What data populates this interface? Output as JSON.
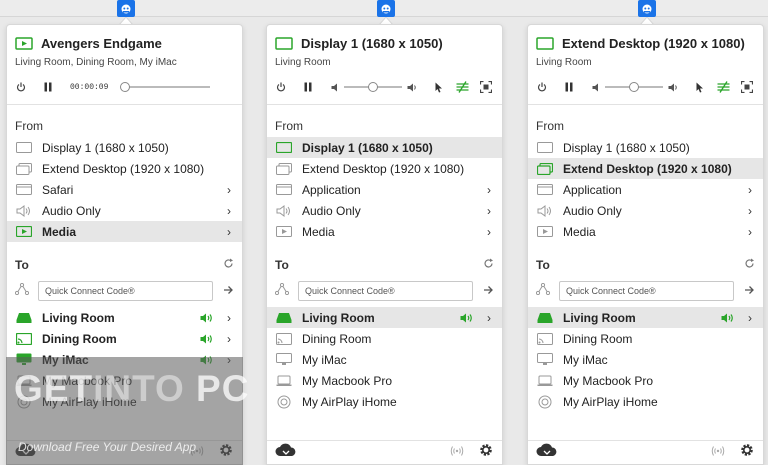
{
  "colors": {
    "accent_green": "#2aa52a",
    "selection_gray": "#e6e6e6",
    "menubar_icon_blue": "#1a73e8"
  },
  "panels": [
    {
      "header": {
        "title": "Avengers Endgame",
        "subtitle": "Living Room, Dining Room, My iMac",
        "title_icon": "media-play-icon",
        "timecode": "00:00:09"
      },
      "from_label": "From",
      "from_items": [
        {
          "label": "Display 1 (1680 x 1050)",
          "icon": "display-icon",
          "selected": false,
          "chevron": false
        },
        {
          "label": "Extend Desktop (1920 x 1080)",
          "icon": "extend-desktop-icon",
          "selected": false,
          "chevron": false
        },
        {
          "label": "Safari",
          "icon": "window-icon",
          "selected": false,
          "chevron": true
        },
        {
          "label": "Audio Only",
          "icon": "speaker-icon",
          "selected": false,
          "chevron": true
        },
        {
          "label": "Media",
          "icon": "media-play-icon",
          "selected": true,
          "chevron": true
        }
      ],
      "to_label": "To",
      "quick_connect_placeholder": "Quick Connect Code®",
      "to_items": [
        {
          "label": "Living Room",
          "icon": "appletv-icon",
          "active": true,
          "selected": false,
          "volume": true,
          "chevron": true
        },
        {
          "label": "Dining Room",
          "icon": "cast-icon",
          "active": true,
          "selected": false,
          "volume": true,
          "chevron": true
        },
        {
          "label": "My iMac",
          "icon": "imac-icon",
          "active": true,
          "selected": false,
          "volume": true,
          "chevron": true
        },
        {
          "label": "My Macbook Pro",
          "icon": "laptop-icon",
          "active": false,
          "selected": false,
          "volume": false,
          "chevron": false
        },
        {
          "label": "My AirPlay iHome",
          "icon": "speaker-round-icon",
          "active": false,
          "selected": false,
          "volume": false,
          "chevron": false
        }
      ]
    },
    {
      "header": {
        "title": "Display 1 (1680 x 1050)",
        "subtitle": "Living Room",
        "title_icon": "display-icon"
      },
      "from_label": "From",
      "from_items": [
        {
          "label": "Display 1 (1680 x 1050)",
          "icon": "display-icon",
          "selected": true,
          "chevron": false
        },
        {
          "label": "Extend Desktop (1920 x 1080)",
          "icon": "extend-desktop-icon",
          "selected": false,
          "chevron": false
        },
        {
          "label": "Application",
          "icon": "window-icon",
          "selected": false,
          "chevron": true
        },
        {
          "label": "Audio Only",
          "icon": "speaker-icon",
          "selected": false,
          "chevron": true
        },
        {
          "label": "Media",
          "icon": "media-play-icon",
          "selected": false,
          "chevron": true
        }
      ],
      "to_label": "To",
      "quick_connect_placeholder": "Quick Connect Code®",
      "to_items": [
        {
          "label": "Living Room",
          "icon": "appletv-icon",
          "active": true,
          "selected": true,
          "volume": true,
          "chevron": true
        },
        {
          "label": "Dining Room",
          "icon": "cast-icon",
          "active": false,
          "selected": false,
          "volume": false,
          "chevron": false
        },
        {
          "label": "My iMac",
          "icon": "imac-icon",
          "active": false,
          "selected": false,
          "volume": false,
          "chevron": false
        },
        {
          "label": "My Macbook Pro",
          "icon": "laptop-icon",
          "active": false,
          "selected": false,
          "volume": false,
          "chevron": false
        },
        {
          "label": "My AirPlay iHome",
          "icon": "speaker-round-icon",
          "active": false,
          "selected": false,
          "volume": false,
          "chevron": false
        }
      ]
    },
    {
      "header": {
        "title": "Extend Desktop (1920 x 1080)",
        "subtitle": "Living Room",
        "title_icon": "display-icon"
      },
      "from_label": "From",
      "from_items": [
        {
          "label": "Display 1 (1680 x 1050)",
          "icon": "display-icon",
          "selected": false,
          "chevron": false
        },
        {
          "label": "Extend Desktop (1920 x 1080)",
          "icon": "extend-desktop-icon",
          "selected": true,
          "chevron": false
        },
        {
          "label": "Application",
          "icon": "window-icon",
          "selected": false,
          "chevron": true
        },
        {
          "label": "Audio Only",
          "icon": "speaker-icon",
          "selected": false,
          "chevron": true
        },
        {
          "label": "Media",
          "icon": "media-play-icon",
          "selected": false,
          "chevron": true
        }
      ],
      "to_label": "To",
      "quick_connect_placeholder": "Quick Connect Code®",
      "to_items": [
        {
          "label": "Living Room",
          "icon": "appletv-icon",
          "active": true,
          "selected": true,
          "volume": true,
          "chevron": true
        },
        {
          "label": "Dining Room",
          "icon": "cast-icon",
          "active": false,
          "selected": false,
          "volume": false,
          "chevron": false
        },
        {
          "label": "My iMac",
          "icon": "imac-icon",
          "active": false,
          "selected": false,
          "volume": false,
          "chevron": false
        },
        {
          "label": "My Macbook Pro",
          "icon": "laptop-icon",
          "active": false,
          "selected": false,
          "volume": false,
          "chevron": false
        },
        {
          "label": "My AirPlay iHome",
          "icon": "speaker-round-icon",
          "active": false,
          "selected": false,
          "volume": false,
          "chevron": false
        }
      ]
    }
  ],
  "watermark": {
    "logo_text_a": "GET",
    "logo_text_b": "INTO",
    "logo_text_c": " PC",
    "tagline": "Download Free Your Desired App"
  }
}
